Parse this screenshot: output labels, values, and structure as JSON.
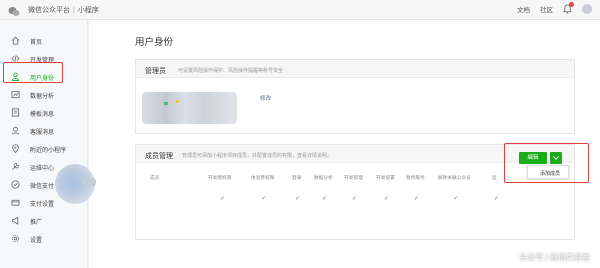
{
  "topbar": {
    "brand": "微信公众平台",
    "product": "小程序",
    "docs": "文档",
    "community": "社区",
    "icons": [
      "wechat-logo-icon",
      "bell-icon",
      "avatar"
    ]
  },
  "sidebar": {
    "items": [
      {
        "label": "首页",
        "icon": "home-icon"
      },
      {
        "label": "开发管理",
        "icon": "code-icon"
      },
      {
        "label": "用户身份",
        "icon": "user-icon",
        "active": true
      },
      {
        "label": "数据分析",
        "icon": "chart-icon"
      },
      {
        "label": "模板消息",
        "icon": "template-icon"
      },
      {
        "label": "客服消息",
        "icon": "service-icon"
      },
      {
        "label": "附近的小程序",
        "icon": "location-icon"
      },
      {
        "label": "运维中心",
        "icon": "wrench-icon"
      },
      {
        "label": "微信支付",
        "icon": "pay-icon"
      },
      {
        "label": "支付设置",
        "icon": "pay-settings-icon"
      },
      {
        "label": "推广",
        "icon": "promote-icon"
      },
      {
        "label": "设置",
        "icon": "gear-icon"
      }
    ]
  },
  "page": {
    "title": "用户身份"
  },
  "admin_card": {
    "title": "管理员",
    "desc": "可设置风险操作保护、风险操作提醒等账号安全",
    "modify": "修改"
  },
  "members_card": {
    "title": "成员管理",
    "desc": "管理员可添加小程序项目成员，并配置成员的权限，查看详情说明。",
    "edit": "编辑",
    "dropdown_item": "添加成员",
    "columns": [
      "成员",
      "开发者权限",
      "体验者权限",
      "登录",
      "数据分析",
      "开发管理",
      "开发设置",
      "暂停服务",
      "解除关联公众号",
      "监"
    ],
    "row_checks": [
      "✓",
      "✓",
      "✓",
      "✓",
      "✓",
      "✓",
      "✓",
      "✓",
      "✓"
    ]
  },
  "colors": {
    "accent": "#1aad19",
    "highlight_box": "#e0413a",
    "link": "#576b95"
  },
  "watermark": "头条号 / 霞逝实验室"
}
